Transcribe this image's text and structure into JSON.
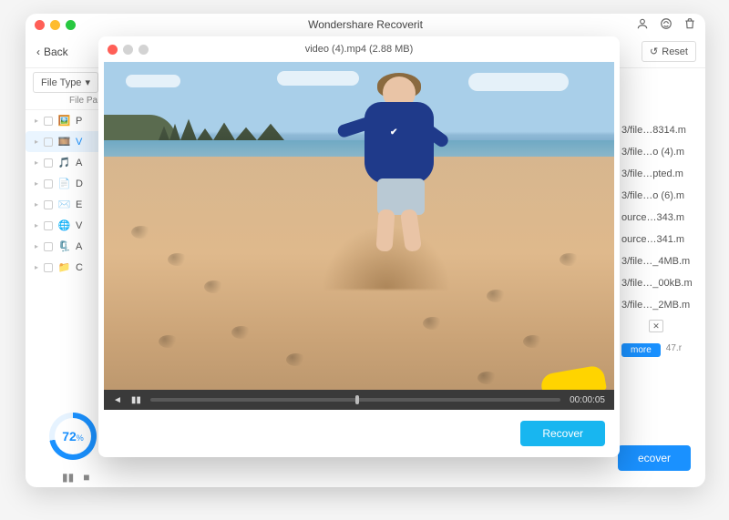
{
  "app": {
    "title": "Wondershare Recoverit"
  },
  "titlebar_icons": {
    "user": "user-icon",
    "support": "support-icon",
    "trash": "trash-icon"
  },
  "toolbar": {
    "back_label": "Back",
    "filetype_label": "File Type",
    "reset_label": "Reset"
  },
  "sidebar": {
    "header": "File Pa",
    "items": [
      {
        "icon": "🖼️",
        "label": "P",
        "name": "photo"
      },
      {
        "icon": "🎞️",
        "label": "V",
        "name": "video",
        "active": true
      },
      {
        "icon": "🎵",
        "label": "A",
        "name": "audio"
      },
      {
        "icon": "📄",
        "label": "D",
        "name": "document"
      },
      {
        "icon": "✉️",
        "label": "E",
        "name": "email"
      },
      {
        "icon": "🌐",
        "label": "V",
        "name": "web"
      },
      {
        "icon": "🗜️",
        "label": "A",
        "name": "archive"
      },
      {
        "icon": "📁",
        "label": "C",
        "name": "other"
      }
    ]
  },
  "paths": [
    "3/file…8314.m",
    "3/file…o (4).m",
    "3/file…pted.m",
    "3/file…o (6).m",
    "ource…343.m",
    "ource…341.m",
    "3/file…_4MB.m",
    "3/file…_00kB.m",
    "3/file…_2MB.m"
  ],
  "more_label": "more",
  "last_size": "47.r",
  "progress": {
    "percent": "72",
    "suffix": "%"
  },
  "main_recover_label": "ecover",
  "preview": {
    "title": "video (4).mp4 (2.88 MB)",
    "timecode": "00:00:05",
    "recover_label": "Recover"
  }
}
